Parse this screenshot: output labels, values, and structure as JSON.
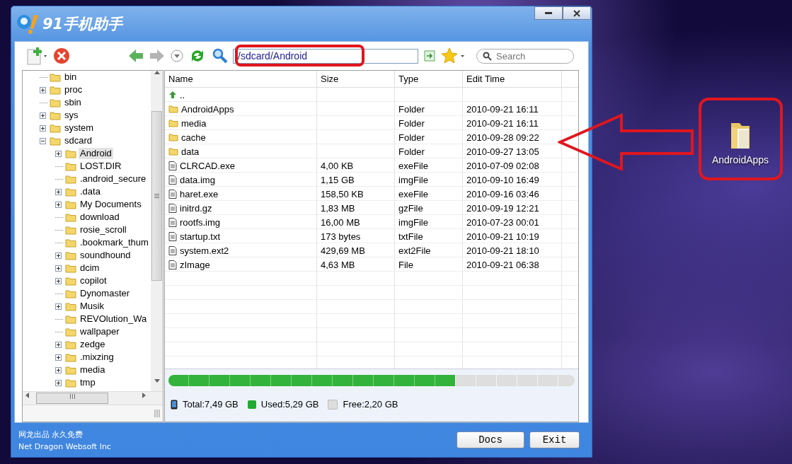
{
  "window": {
    "title": "91手机助手"
  },
  "toolbar": {
    "address": "/sdcard/Android",
    "search": {
      "placeholder": "Search"
    }
  },
  "tree": [
    {
      "label": "bin",
      "selected": false
    },
    {
      "label": "proc",
      "expanded": false,
      "selected": false
    },
    {
      "label": "sbin",
      "selected": false
    },
    {
      "label": "sys",
      "expanded": false,
      "selected": false
    },
    {
      "label": "system",
      "expanded": false,
      "selected": false
    },
    {
      "label": "sdcard",
      "expanded": true,
      "selected": false,
      "children": [
        {
          "label": "Android",
          "expanded": false,
          "selected": true
        },
        {
          "label": "LOST.DIR",
          "selected": false
        },
        {
          "label": ".android_secure",
          "selected": false
        },
        {
          "label": ".data",
          "expanded": false,
          "selected": false
        },
        {
          "label": "My Documents",
          "expanded": false,
          "selected": false
        },
        {
          "label": "download",
          "selected": false
        },
        {
          "label": "rosie_scroll",
          "selected": false
        },
        {
          "label": ".bookmark_thum",
          "selected": false
        },
        {
          "label": "soundhound",
          "expanded": false,
          "selected": false
        },
        {
          "label": "dcim",
          "expanded": false,
          "selected": false
        },
        {
          "label": "copilot",
          "expanded": false,
          "selected": false
        },
        {
          "label": "Dynomaster",
          "selected": false
        },
        {
          "label": "Musik",
          "expanded": false,
          "selected": false
        },
        {
          "label": "REVOlution_Wa",
          "selected": false
        },
        {
          "label": "wallpaper",
          "selected": false
        },
        {
          "label": "zedge",
          "expanded": false,
          "selected": false
        },
        {
          "label": ".mixzing",
          "expanded": false,
          "selected": false
        },
        {
          "label": "media",
          "expanded": false,
          "selected": false
        },
        {
          "label": "tmp",
          "expanded": false,
          "selected": false
        }
      ]
    }
  ],
  "table": {
    "columns": [
      "Name",
      "Size",
      "Type",
      "Edit Time"
    ],
    "rows": [
      {
        "kind": "up",
        "name": ".."
      },
      {
        "kind": "folder",
        "name": "AndroidApps",
        "type": "Folder",
        "time": "2010-09-21 16:11"
      },
      {
        "kind": "folder",
        "name": "media",
        "type": "Folder",
        "time": "2010-09-21 16:11"
      },
      {
        "kind": "folder",
        "name": "cache",
        "type": "Folder",
        "time": "2010-09-28 09:22"
      },
      {
        "kind": "folder",
        "name": "data",
        "type": "Folder",
        "time": "2010-09-27 13:05"
      },
      {
        "kind": "file",
        "name": "CLRCAD.exe",
        "size": "4,00 KB",
        "type": "exeFile",
        "time": "2010-07-09 02:08"
      },
      {
        "kind": "file",
        "name": "data.img",
        "size": "1,15 GB",
        "type": "imgFile",
        "time": "2010-09-10 16:49"
      },
      {
        "kind": "file",
        "name": "haret.exe",
        "size": "158,50 KB",
        "type": "exeFile",
        "time": "2010-09-16 03:46"
      },
      {
        "kind": "file",
        "name": "initrd.gz",
        "size": "1,83 MB",
        "type": "gzFile",
        "time": "2010-09-19 12:21"
      },
      {
        "kind": "file",
        "name": "rootfs.img",
        "size": "16,00 MB",
        "type": "imgFile",
        "time": "2010-07-23 00:01"
      },
      {
        "kind": "file",
        "name": "startup.txt",
        "size": "173 bytes",
        "type": "txtFile",
        "time": "2010-09-21 10:19"
      },
      {
        "kind": "file",
        "name": "system.ext2",
        "size": "429,69 MB",
        "type": "ext2File",
        "time": "2010-09-21 18:10"
      },
      {
        "kind": "file",
        "name": "zImage",
        "size": "4,63 MB",
        "type": "File",
        "time": "2010-09-21 06:38"
      }
    ]
  },
  "storage": {
    "level": 0.706,
    "total": "Total:7,49 GB",
    "used": "Used:5,29 GB",
    "free": "Free:2,20 GB"
  },
  "footer": {
    "line_1": "网龙出品 永久免费",
    "line_2": "Net Dragon Websoft Inc",
    "buttons": [
      "Docs",
      "Exit"
    ]
  },
  "desktop_icon": {
    "label": "AndroidApps"
  }
}
